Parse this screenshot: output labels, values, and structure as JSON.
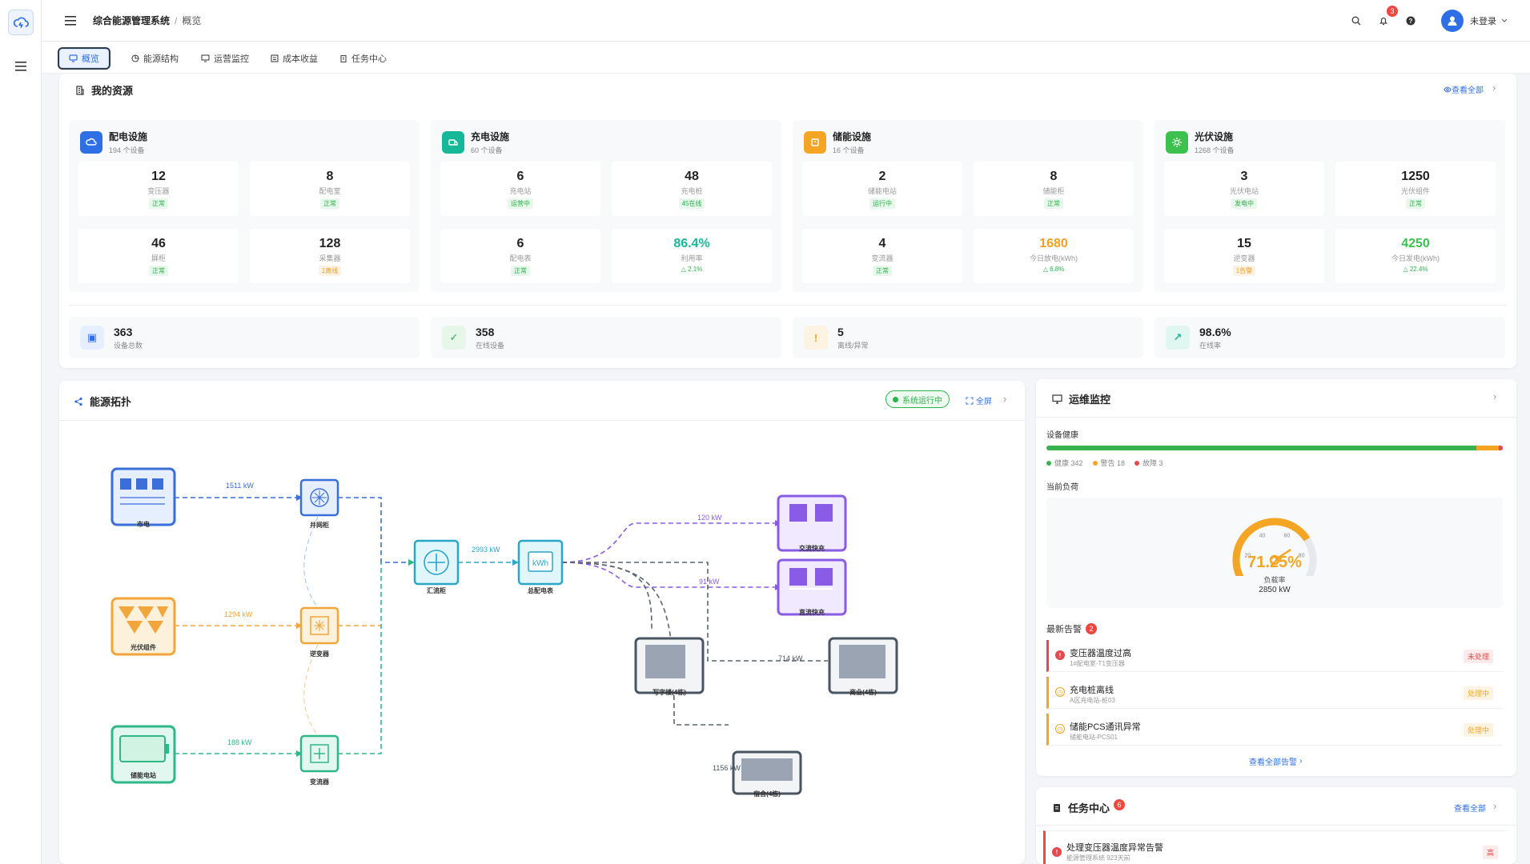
{
  "app": {
    "title": "综合能源管理系统",
    "current_page": "概览",
    "notifications": "3",
    "user": "未登录"
  },
  "tabs": [
    {
      "label": "概览",
      "active": true,
      "icon": "monitor-icon"
    },
    {
      "label": "能源结构",
      "icon": "pie-icon"
    },
    {
      "label": "运营监控",
      "icon": "display-icon"
    },
    {
      "label": "成本收益",
      "icon": "calculator-icon"
    },
    {
      "label": "任务中心",
      "icon": "clipboard-icon"
    }
  ],
  "resources": {
    "title": "我的资源",
    "view_all": "查看全部",
    "groups": [
      {
        "name": "配电设施",
        "sub": "194 个设备",
        "color": "#2f6fe5",
        "metrics": [
          {
            "value": "12",
            "label": "变压器",
            "status": "正常",
            "kind": "g"
          },
          {
            "value": "8",
            "label": "配电室",
            "status": "正常",
            "kind": "g"
          },
          {
            "value": "46",
            "label": "屏柜",
            "status": "正常",
            "kind": "g"
          },
          {
            "value": "128",
            "label": "采集器",
            "status": "1离线",
            "kind": "o"
          }
        ]
      },
      {
        "name": "充电设施",
        "sub": "60 个设备",
        "color": "#17b897",
        "metrics": [
          {
            "value": "6",
            "label": "充电站",
            "status": "运营中",
            "kind": "g"
          },
          {
            "value": "48",
            "label": "充电桩",
            "status": "45在线",
            "kind": "g"
          },
          {
            "value": "6",
            "label": "配电表",
            "status": "正常",
            "kind": "g"
          },
          {
            "value": "86.4%",
            "label": "利用率",
            "trend": "2.1%",
            "valcolor": "#17b897"
          }
        ]
      },
      {
        "name": "储能设施",
        "sub": "16 个设备",
        "color": "#f5a524",
        "metrics": [
          {
            "value": "2",
            "label": "储能电站",
            "status": "运行中",
            "kind": "g"
          },
          {
            "value": "8",
            "label": "储能柜",
            "status": "正常",
            "kind": "g"
          },
          {
            "value": "4",
            "label": "变流器",
            "status": "正常",
            "kind": "g"
          },
          {
            "value": "1680",
            "label": "今日放电(kWh)",
            "trend": "6.8%",
            "valcolor": "#f0a020"
          }
        ]
      },
      {
        "name": "光伏设施",
        "sub": "1268 个设备",
        "color": "#3cc14e",
        "metrics": [
          {
            "value": "3",
            "label": "光伏电站",
            "status": "发电中",
            "kind": "g"
          },
          {
            "value": "1250",
            "label": "光伏组件",
            "status": "正常",
            "kind": "g"
          },
          {
            "value": "15",
            "label": "逆变器",
            "status": "1告警",
            "kind": "o"
          },
          {
            "value": "4250",
            "label": "今日发电(kWh)",
            "trend": "22.4%",
            "valcolor": "#3cc14e"
          }
        ]
      }
    ],
    "summary": [
      {
        "value": "363",
        "label": "设备总数",
        "color": "#2f6fe5",
        "bg": "#e6efff"
      },
      {
        "value": "358",
        "label": "在线设备",
        "color": "#2bb24c",
        "bg": "#e6f7ea"
      },
      {
        "value": "5",
        "label": "离线/异常",
        "color": "#f5a524",
        "bg": "#fdf3e2"
      },
      {
        "value": "98.6%",
        "label": "在线率",
        "color": "#17b897",
        "bg": "#e0f6f1"
      }
    ]
  },
  "topology": {
    "title": "能源拓扑",
    "status": "系统运行中",
    "fullscreen": "全屏",
    "nodes": {
      "grid": "市电",
      "grid_cabinet": "并网柜",
      "pv": "光伏组件",
      "inverter": "逆变器",
      "storage": "储能电站",
      "converter": "变流器",
      "combiner": "汇流柜",
      "meter": "总配电表",
      "ac_pile": "交流快充",
      "dc_pile": "直流快充",
      "office": "写字楼(4栋)",
      "mall": "商业(4栋)",
      "dorm": "宿舍(4栋)"
    },
    "flows": {
      "grid": "1511 kW",
      "pv": "1294 kW",
      "storage": "188 kW",
      "total": "2993 kW",
      "ac": "120 kW",
      "dc": "91 kW",
      "office": "714 kW",
      "dorm": "1156 kW"
    }
  },
  "ops": {
    "title": "运维监控",
    "health_label": "设备健康",
    "healthy": 342,
    "warning": 18,
    "fault": 3,
    "legend": {
      "healthy": "健康 342",
      "warning": "警告 18",
      "fault": "故障 3"
    },
    "load_label": "当前负荷",
    "gauge": {
      "value": 71.25,
      "display": "71.25%",
      "label": "负载率",
      "power": "2850 kW",
      "ticks": [
        "20",
        "40",
        "60",
        "80"
      ]
    },
    "alerts_title": "最新告警",
    "alerts_count": "2",
    "alerts": [
      {
        "title": "变压器温度过高",
        "sub": "1#配电室-T1变压器",
        "tag": "未处理",
        "color": "#e5484d"
      },
      {
        "title": "充电桩离线",
        "sub": "A区充电站-桩03",
        "tag": "处理中",
        "color": "#f5a524"
      },
      {
        "title": "储能PCS通讯异常",
        "sub": "储能电站-PCS01",
        "tag": "处理中",
        "color": "#f5a524"
      }
    ],
    "view_all_alerts": "查看全部告警"
  },
  "tasks": {
    "title": "任务中心",
    "count": "6",
    "view_all": "查看全部",
    "items": [
      {
        "title": "处理变压器温度异常告警",
        "sub": "能源管理系统  923天前",
        "priority": "高"
      }
    ]
  }
}
